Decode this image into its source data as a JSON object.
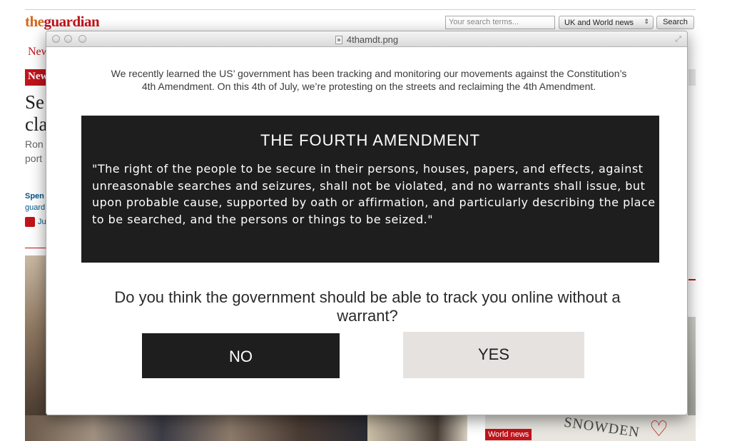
{
  "site": {
    "logo_the": "the",
    "logo_guardian": "guardian",
    "search_placeholder": "Your search terms...",
    "section_select": "UK and World news",
    "search_button": "Search",
    "nav_fragment": "New",
    "badge_fragment": "New",
    "headline_fragment_1": "Se",
    "headline_fragment_2": "cla",
    "sub_fragment_1": "Ron",
    "sub_fragment_2": "port",
    "byline_fragment": "Spen",
    "source_fragment": "guard",
    "comment_fragment": "Ju",
    "world_news_badge": "World news",
    "graffiti_text": "SNOWDEN",
    "brand_red": "#c0141b"
  },
  "window": {
    "title": "4thamdt.png"
  },
  "overlay": {
    "intro": "We recently learned the US’ government has been tracking and monitoring our movements against the Constitution’s 4th Amendment. On this 4th of July, we’re protesting on the streets and reclaiming the 4th Amendment.",
    "amendment_title": "THE FOURTH AMENDMENT",
    "amendment_quote": "\"The right of the people to be secure in their persons, houses, papers, and effects, against unreasonable searches and seizures, shall not be violated, and no warrants shall issue, but upon probable cause, supported by oath or affirmation, and particularly describing the place to be searched, and the persons or things to be seized.\"",
    "question": "Do you think the government should be able to track you online without a warrant?",
    "no_label": "NO",
    "yes_label": "YES",
    "box_color": "#1e1e1e",
    "yes_color": "#e5e2e0"
  }
}
